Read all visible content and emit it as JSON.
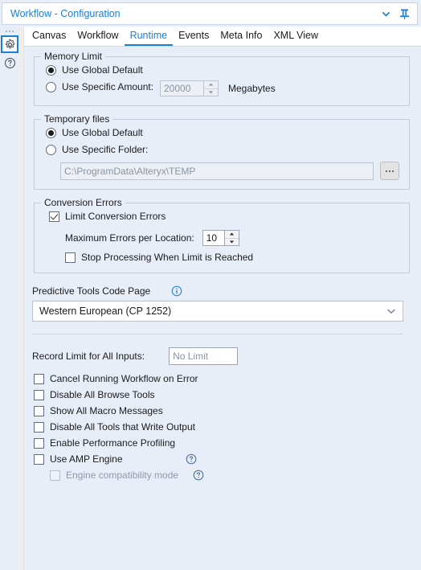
{
  "window": {
    "title": "Workflow - Configuration",
    "collapse_icon": "chevron-down-icon",
    "pin_icon": "pin-icon"
  },
  "rail": {
    "items": [
      {
        "name": "configuration",
        "icon": "gear-icon",
        "active": true
      },
      {
        "name": "help",
        "icon": "question-circle-icon",
        "active": false
      }
    ]
  },
  "tabs": [
    {
      "label": "Canvas",
      "active": false
    },
    {
      "label": "Workflow",
      "active": false
    },
    {
      "label": "Runtime",
      "active": true
    },
    {
      "label": "Events",
      "active": false
    },
    {
      "label": "Meta Info",
      "active": false
    },
    {
      "label": "XML View",
      "active": false
    }
  ],
  "memory_limit": {
    "title": "Memory Limit",
    "use_global_default": {
      "label": "Use Global Default",
      "checked": true
    },
    "use_specific_amount": {
      "label": "Use Specific Amount:",
      "checked": false
    },
    "amount_value": "20000",
    "units_label": "Megabytes"
  },
  "temporary_files": {
    "title": "Temporary files",
    "use_global_default": {
      "label": "Use Global Default",
      "checked": true
    },
    "use_specific_folder": {
      "label": "Use Specific Folder:",
      "checked": false
    },
    "folder_path": "C:\\ProgramData\\Alteryx\\TEMP",
    "browse_label": "..."
  },
  "conversion_errors": {
    "title": "Conversion Errors",
    "limit_conversion_errors": {
      "label": "Limit Conversion Errors",
      "checked": true
    },
    "max_errors_label": "Maximum Errors per Location:",
    "max_errors_value": "10",
    "stop_processing": {
      "label": "Stop Processing When Limit is Reached",
      "checked": false
    }
  },
  "code_page": {
    "label": "Predictive Tools Code Page",
    "info_icon": "info-icon",
    "selected": "Western European (CP 1252)",
    "chevron_icon": "chevron-down-icon"
  },
  "record_limit": {
    "label": "Record Limit for All Inputs:",
    "placeholder": "No Limit",
    "value": ""
  },
  "options": [
    {
      "label": "Cancel Running Workflow on Error",
      "checked": false,
      "disabled": false,
      "help": false
    },
    {
      "label": "Disable All Browse Tools",
      "checked": false,
      "disabled": false,
      "help": false
    },
    {
      "label": "Show All Macro Messages",
      "checked": false,
      "disabled": false,
      "help": false
    },
    {
      "label": "Disable All Tools that Write Output",
      "checked": false,
      "disabled": false,
      "help": false
    },
    {
      "label": "Enable Performance Profiling",
      "checked": false,
      "disabled": false,
      "help": false
    },
    {
      "label": "Use AMP Engine",
      "checked": false,
      "disabled": false,
      "help": true
    },
    {
      "label": "Engine compatibility mode",
      "checked": false,
      "disabled": true,
      "help": true,
      "indent": true
    }
  ],
  "colors": {
    "accent": "#1b7fd4",
    "background": "#e8eef8",
    "panel": "#ffffff",
    "border": "#c3cbd8"
  }
}
